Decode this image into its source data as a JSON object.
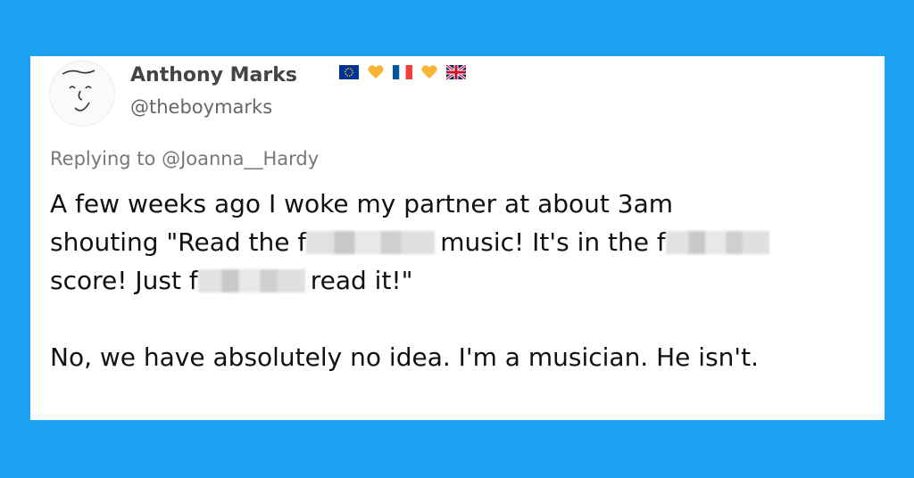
{
  "tweet": {
    "author": {
      "name": "Anthony Marks",
      "handle": "@theboymarks",
      "flags": [
        "eu-flag-icon",
        "heart-icon",
        "france-flag-icon",
        "heart-icon",
        "uk-flag-icon"
      ]
    },
    "replying_to": "Replying to @Joanna__Hardy",
    "line1": "A few weeks ago I woke my partner at about 3am",
    "line2_a": "shouting \"Read the f",
    "line2_b": "music! It's in the f",
    "line3_a": "score! Just f",
    "line3_b": "read it!\"",
    "para2": "No, we have absolutely no idea. I'm a musician. He isn't."
  },
  "colors": {
    "background": "#1da1f2",
    "card": "#ffffff",
    "heart": "#f7b733"
  }
}
